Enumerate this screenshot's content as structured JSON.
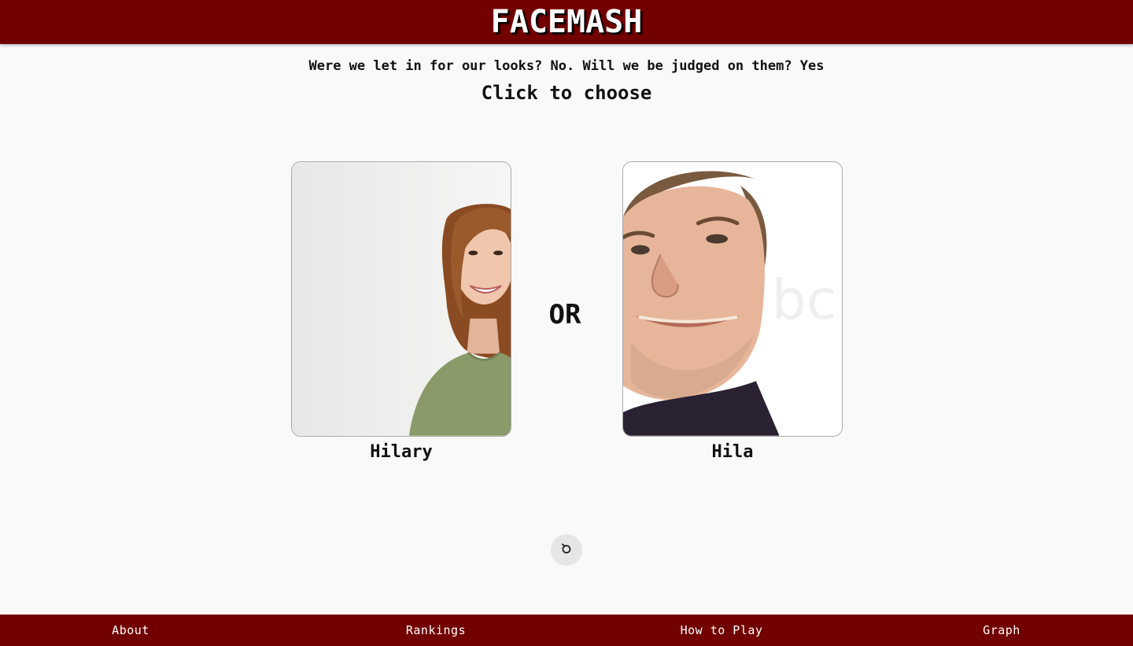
{
  "header": {
    "title": "FACEMASH"
  },
  "intro": {
    "tagline": "Were we let in for our looks? No. Will we be judged on them? Yes",
    "instruction": "Click to choose"
  },
  "contestants": {
    "left": {
      "name": "Hilary"
    },
    "right": {
      "name": "Hila"
    }
  },
  "versus_label": "OR",
  "reset": {
    "icon": "refresh-icon"
  },
  "footer": {
    "links": [
      "About",
      "Rankings",
      "How to Play",
      "Graph"
    ]
  },
  "colors": {
    "brand": "#720000",
    "background": "#f9f9f9",
    "text": "#111111"
  }
}
